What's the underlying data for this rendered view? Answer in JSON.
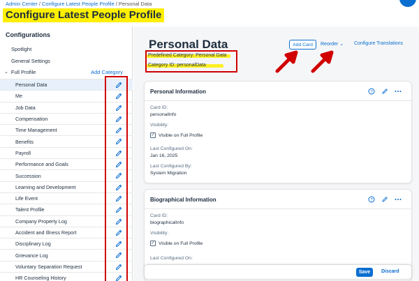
{
  "breadcrumb": {
    "items": [
      "Admin Center",
      "Configure Latest People Profile",
      "Personal Data"
    ],
    "separator": "/"
  },
  "page": {
    "title": "Configure Latest People Profile"
  },
  "left_pane": {
    "title": "Configurations",
    "top_items": [
      "Spotlight",
      "General Settings"
    ],
    "full_profile": {
      "label": "Full Profile",
      "add_category": "Add Category"
    },
    "categories": [
      "Personal Data",
      "Me",
      "Job Data",
      "Compensation",
      "Time Management",
      "Benefits",
      "Payroll",
      "Performance and Goals",
      "Succession",
      "Learning and Development",
      "Life Event",
      "Talent Profile",
      "Company Property Log",
      "Accident and Illness Report",
      "Disciplinary Log",
      "Grievance Log",
      "Voluntary Separation Request",
      "HR Counseling History"
    ],
    "selected_index": 0
  },
  "section": {
    "title": "Personal Data",
    "predefined_category": "Predefined Category: Personal Data",
    "category_id": "Category ID: personalData",
    "add_card": "Add Card",
    "reorder": "Reorder",
    "configure_translations": "Configure Translations"
  },
  "cards": [
    {
      "title": "Personal Information",
      "card_id_label": "Card ID:",
      "card_id": "personalInfo",
      "visibility_label": "Visibility:",
      "visible_label": "Visible on Full Profile",
      "last_configured_on_label": "Last Configured On:",
      "last_configured_on": "Jan 16, 2025",
      "last_configured_by_label": "Last Configured By:",
      "last_configured_by": "System Migration"
    },
    {
      "title": "Biographical Information",
      "card_id_label": "Card ID:",
      "card_id": "biographicalInfo",
      "visibility_label": "Visibility:",
      "visible_label": "Visible on Full Profile",
      "last_configured_on_label": "Last Configured On:"
    }
  ],
  "footer": {
    "save": "Save",
    "discard": "Discard"
  },
  "colors": {
    "accent": "#0a6ed1",
    "highlight": "#ffef00",
    "annotation": "#d00000"
  }
}
